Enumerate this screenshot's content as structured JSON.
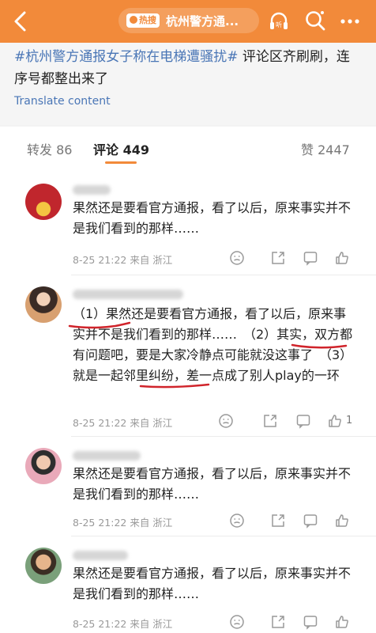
{
  "header": {
    "hot_badge": "热搜",
    "title": "杭州警方通..."
  },
  "post": {
    "hashtag": "#杭州警方通报女子称在电梯遭骚扰#",
    "text": " 评论区齐刷刷，连序号都整出来了",
    "translate": "Translate content"
  },
  "tabs": [
    {
      "label": "转发 86"
    },
    {
      "label": "评论 449"
    },
    {
      "label": "赞 2447"
    }
  ],
  "comments": [
    {
      "text": "果然还是要看官方通报，看了以后，原来事实并不是我们看到的那样……",
      "meta": "8-25 21:22 来自 浙江",
      "likes": ""
    },
    {
      "text": "（1）果然还是要看官方通报，看了以后，原来事实并不是我们看到的那样……　（2）其实，双方都有问题吧，要是大家冷静点可能就没这事了　（3）就是一起邻里纠纷，差一点成了别人play的一环",
      "meta": "8-25 21:22 来自 浙江",
      "likes": "1"
    },
    {
      "text": "果然还是要看官方通报，看了以后，原来事实并不是我们看到的那样……",
      "meta": "8-25 21:22 来自 浙江",
      "likes": ""
    },
    {
      "text": "果然还是要看官方通报，看了以后，原来事实并不是我们看到的那样……",
      "meta": "8-25 21:22 来自 浙江",
      "likes": ""
    }
  ],
  "icons": {
    "back": "back-arrow-icon",
    "listen": "headphones-icon",
    "search": "search-icon",
    "more": "more-icon",
    "emoji": "emoji-icon",
    "share": "share-icon",
    "reply": "comment-icon",
    "like": "thumbs-up-icon"
  },
  "colors": {
    "header": "#f28a3a",
    "link": "#4a76b6",
    "accent": "#f28a3a",
    "annotation": "#d0242b"
  }
}
